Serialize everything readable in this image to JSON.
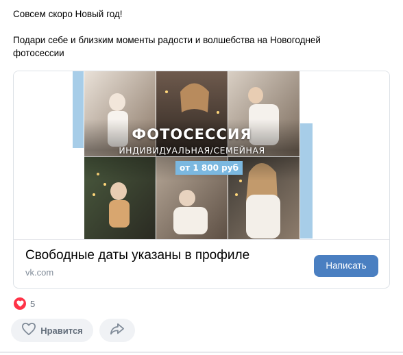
{
  "post": {
    "text_line1": "Совсем скоро Новый год!",
    "text_line2": "Подари себе и близким моменты радости и волшебства на Новогодней",
    "text_line3": "фотосессии"
  },
  "promo_image": {
    "title": "ФОТОСЕССИЯ",
    "subtitle": "ИНДИВИДУАЛЬНАЯ/СЕМЕЙНАЯ",
    "price": "от 1 800 руб"
  },
  "card": {
    "caption": "Свободные даты указаны в профиле",
    "domain": "vk.com",
    "button_label": "Написать"
  },
  "reactions": {
    "count": "5",
    "icon": "heart-icon"
  },
  "actions": {
    "like_label": "Нравится",
    "like_icon": "heart-outline-icon",
    "share_icon": "share-arrow-icon"
  },
  "colors": {
    "accent_button": "#4a7fc1",
    "accent_bar": "#a7cde8",
    "reaction_red": "#ff3347",
    "muted_text": "#818c99"
  }
}
